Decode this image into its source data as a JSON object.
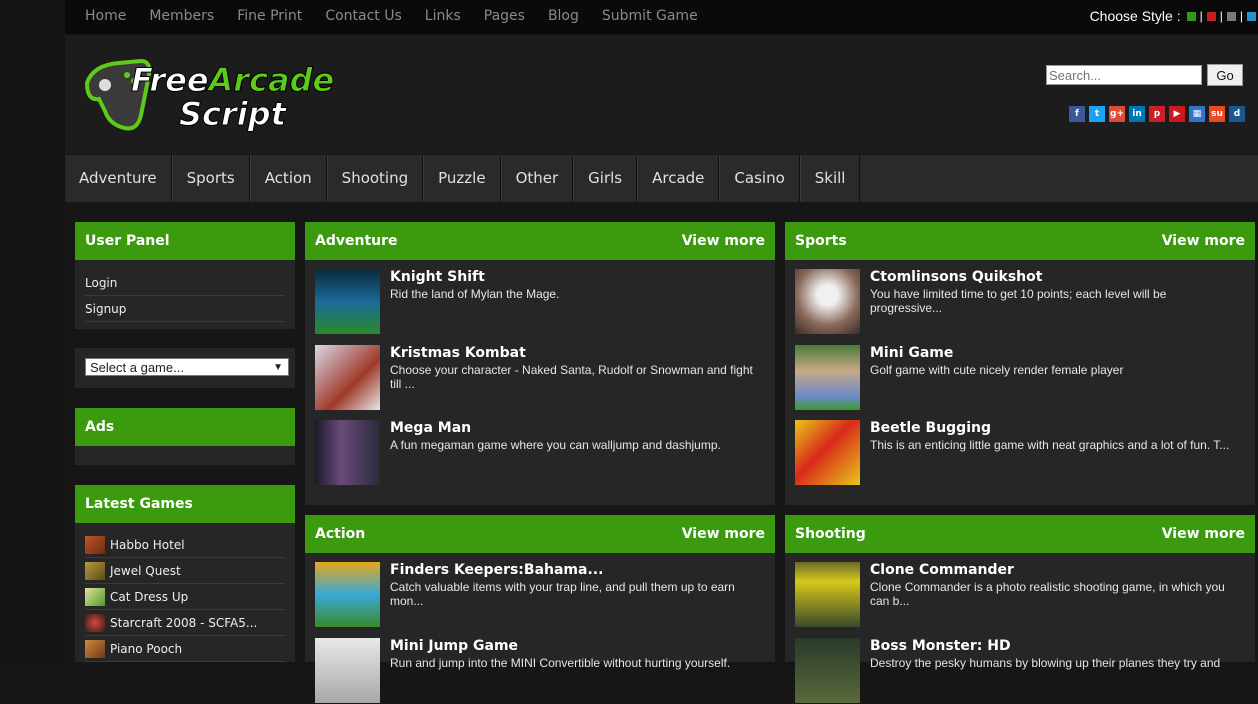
{
  "topnav": [
    "Home",
    "Members",
    "Fine Print",
    "Contact Us",
    "Links",
    "Pages",
    "Blog",
    "Submit Game"
  ],
  "style_chooser": {
    "label": "Choose Style :",
    "colors": [
      "#2f9a1a",
      "#c81e1e",
      "#7a7a7a",
      "#2a8fd0"
    ]
  },
  "logo": {
    "line1": "FreeArcade",
    "line2": "Script"
  },
  "search": {
    "placeholder": "Search...",
    "button": "Go"
  },
  "socials": [
    {
      "icon": "facebook-icon",
      "glyph": "f",
      "color": "#3b5998"
    },
    {
      "icon": "twitter-icon",
      "glyph": "t",
      "color": "#1da1f2"
    },
    {
      "icon": "googleplus-icon",
      "glyph": "g+",
      "color": "#dd4b39"
    },
    {
      "icon": "linkedin-icon",
      "glyph": "in",
      "color": "#0077b5"
    },
    {
      "icon": "pinterest-icon",
      "glyph": "p",
      "color": "#cb2027"
    },
    {
      "icon": "youtube-icon",
      "glyph": "▶",
      "color": "#cc181e"
    },
    {
      "icon": "delicious-icon",
      "glyph": "▦",
      "color": "#3274d1"
    },
    {
      "icon": "stumbleupon-icon",
      "glyph": "su",
      "color": "#eb4924"
    },
    {
      "icon": "digg-icon",
      "glyph": "d",
      "color": "#1b5891"
    }
  ],
  "categories": [
    "Adventure",
    "Sports",
    "Action",
    "Shooting",
    "Puzzle",
    "Other",
    "Girls",
    "Arcade",
    "Casino",
    "Skill"
  ],
  "sidebar": {
    "user_panel": {
      "title": "User Panel",
      "links": [
        "Login",
        "Signup"
      ]
    },
    "game_select": {
      "value": "Select a game..."
    },
    "ads": {
      "title": "Ads"
    },
    "latest": {
      "title": "Latest Games",
      "items": [
        "Habbo Hotel",
        "Jewel Quest",
        "Cat Dress Up",
        "Starcraft 2008 - SCFA5...",
        "Piano Pooch"
      ]
    }
  },
  "panels": [
    {
      "title": "Adventure",
      "more": "View more",
      "games": [
        {
          "title": "Knight Shift",
          "desc": "Rid the land of Mylan the Mage."
        },
        {
          "title": "Kristmas Kombat",
          "desc": "Choose your character - Naked Santa, Rudolf or Snowman and fight till ..."
        },
        {
          "title": "Mega Man",
          "desc": "A fun megaman game where you can walljump and dashjump."
        }
      ]
    },
    {
      "title": "Sports",
      "more": "View more",
      "games": [
        {
          "title": "Ctomlinsons Quikshot",
          "desc": "You have limited time to get 10 points; each level will be progressive..."
        },
        {
          "title": "Mini Game",
          "desc": "Golf game with cute nicely render female player"
        },
        {
          "title": "Beetle Bugging",
          "desc": "This is an enticing little game with neat graphics and a lot of fun. T..."
        }
      ]
    },
    {
      "title": "Action",
      "more": "View more",
      "games": [
        {
          "title": "Finders Keepers:Bahama...",
          "desc": "Catch valuable items with your trap line, and pull them up to earn mon..."
        },
        {
          "title": "Mini Jump Game",
          "desc": "Run and jump into the MINI Convertible without hurting yourself."
        }
      ]
    },
    {
      "title": "Shooting",
      "more": "View more",
      "games": [
        {
          "title": "Clone Commander",
          "desc": "Clone Commander is a photo realistic shooting game, in which you can b..."
        },
        {
          "title": "Boss Monster: HD",
          "desc": "Destroy the pesky humans by blowing up their planes they try and"
        }
      ]
    }
  ]
}
